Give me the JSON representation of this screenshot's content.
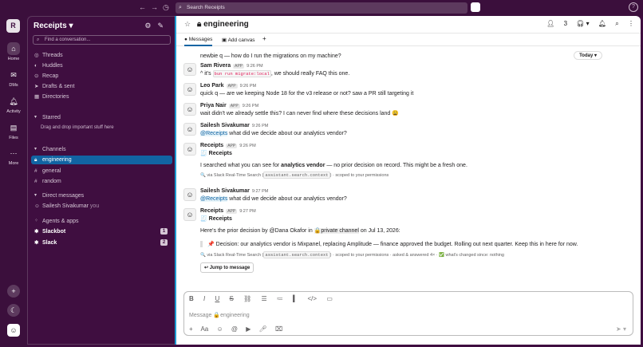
{
  "topbar": {
    "search_placeholder": "Search Receipts"
  },
  "rail": {
    "workspace_initial": "R",
    "items": [
      {
        "label": "Home"
      },
      {
        "label": "DMs"
      },
      {
        "label": "Activity"
      },
      {
        "label": "Files"
      },
      {
        "label": "More"
      }
    ]
  },
  "sidebar": {
    "workspace_name": "Receipts",
    "find_placeholder": "Find a conversation...",
    "nav": [
      "Threads",
      "Huddles",
      "Recap",
      "Drafts & sent",
      "Directories"
    ],
    "starred_label": "Starred",
    "starred_note": "Drag and drop important stuff here",
    "channels_label": "Channels",
    "channels": [
      "engineering",
      "general",
      "random"
    ],
    "dms_label": "Direct messages",
    "dm_user": "Sailesh Sivakumar",
    "dm_you": "you",
    "apps_label": "Agents & apps",
    "apps": [
      {
        "name": "Slackbot",
        "badge": "1"
      },
      {
        "name": "Slack",
        "badge": "2"
      }
    ]
  },
  "channel": {
    "name": "engineering",
    "member_count": "3",
    "tabs": [
      "Messages",
      "Add canvas"
    ],
    "today_label": "Today"
  },
  "messages": [
    {
      "text": "newbie q — how do I run the migrations on my machine?"
    },
    {
      "name": "Sam Rivera",
      "tag": "APP",
      "time": "9:26 PM",
      "pre": "^ it's ",
      "code": "bun run migrate:local",
      "post": ", we should really FAQ this one."
    },
    {
      "name": "Leo Park",
      "tag": "APP",
      "time": "9:26 PM",
      "text": "quick q — are we keeping Node 18 for the v3 release or not? saw a PR still targeting it"
    },
    {
      "name": "Priya Nair",
      "tag": "APP",
      "time": "9:26 PM",
      "text": "wait didn't we already settle this? I can never find where these decisions land 😩"
    },
    {
      "name": "Sailesh Sivakumar",
      "time": "9:26 PM",
      "mention": "@Receipts",
      "text": " what did we decide about our analytics vendor?"
    },
    {
      "name": "Receipts",
      "tag": "APP",
      "time": "9:26 PM",
      "heading": "🧾 Receipts",
      "pre": "I searched what you can see for ",
      "bold": "analytics vendor",
      "post": " — no prior decision on record. This might be a fresh one.",
      "meta_pre": "🔍 via Slack Real-Time Search (",
      "meta_code": "assistant.search.context",
      "meta_post": ") · scoped to your permissions"
    },
    {
      "name": "Sailesh Sivakumar",
      "time": "9:27 PM",
      "mention": "@Receipts",
      "text": " what did we decide about our analytics vendor?"
    },
    {
      "name": "Receipts",
      "tag": "APP",
      "time": "9:27 PM",
      "heading": "🧾 Receipts",
      "pre": "Here's the prior decision by ",
      "bold": "@Dana Okafor",
      "mid": " in ",
      "channel": "🔒private channel",
      "post": " on Jul 13, 2026:",
      "decision": "📌 Decision: our analytics vendor is Mixpanel, replacing Amplitude — finance approved the budget. Rolling out next quarter. Keep this in here for now.",
      "meta_pre": "🔍 via Slack Real-Time Search (",
      "meta_code": "assistant.search.context",
      "meta_post": ") · scoped to your permissions · asked & answered 4× · ✅ what's changed since: nothing",
      "jump": "↩ Jump to message"
    }
  ],
  "composer": {
    "placeholder": "Message 🔒engineering"
  }
}
